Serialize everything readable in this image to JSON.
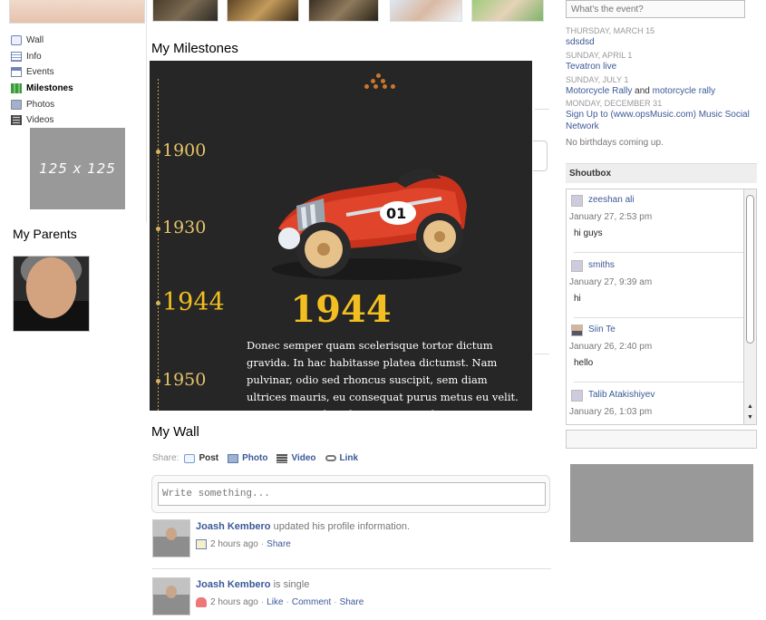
{
  "nav": {
    "items": [
      {
        "label": "Wall"
      },
      {
        "label": "Info"
      },
      {
        "label": "Events"
      },
      {
        "label": "Milestones"
      },
      {
        "label": "Photos"
      },
      {
        "label": "Videos"
      }
    ]
  },
  "left": {
    "ad_text": "125 x 125",
    "parents_title": "My Parents"
  },
  "milestones": {
    "title": "My Milestones",
    "years": [
      "1900",
      "1930",
      "1944",
      "1950"
    ],
    "featured_year": "1944",
    "plate_number": "01",
    "text": "Donec semper quam scelerisque tortor dictum gravida. In hac habitasse platea dictumst. Nam pulvinar, odio sed rhoncus suscipit, sem diam ultrices mauris, eu consequat purus metus eu velit. Proin metus odio, aliquam eget molestie nec, gravida ut sapien. Phasellus quis est sed"
  },
  "wall": {
    "title": "My Wall",
    "share_label": "Share:",
    "share_items": [
      "Post",
      "Photo",
      "Video",
      "Link"
    ],
    "composer_placeholder": "Write something...",
    "feed": [
      {
        "name": "Joash Kembero",
        "action": "updated his profile information.",
        "time": "2 hours ago",
        "links": [
          "Share"
        ]
      },
      {
        "name": "Joash Kembero",
        "action": "is single",
        "time": "2 hours ago",
        "links": [
          "Like",
          "Comment",
          "Share"
        ]
      }
    ]
  },
  "right": {
    "event_placeholder": "What's the event?",
    "events": [
      {
        "date": "THURSDAY, MARCH 15",
        "title": "sdsdsd"
      },
      {
        "date": "SUNDAY, APRIL 1",
        "title": "Tevatron live"
      },
      {
        "date": "SUNDAY, JULY 1",
        "title_a": "Motorcycle Rally",
        "joiner": "and",
        "title_b": "motorcycle rally"
      },
      {
        "date": "MONDAY, DECEMBER 31",
        "title": "Sign Up to (www.opsMusic.com) Music Social Network"
      }
    ],
    "no_birthdays": "No birthdays coming up.",
    "shoutbox_title": "Shoutbox",
    "shouts": [
      {
        "name": "zeeshan ali",
        "time": "January 27, 2:53 pm",
        "message": "hi guys"
      },
      {
        "name": "smiths",
        "time": "January 27, 9:39 am",
        "message": "hi"
      },
      {
        "name": "Siin Te",
        "time": "January 26, 2:40 pm",
        "message": "hello"
      },
      {
        "name": "Talib Atakishiyev",
        "time": "January 26, 1:03 pm",
        "message": ""
      }
    ]
  }
}
